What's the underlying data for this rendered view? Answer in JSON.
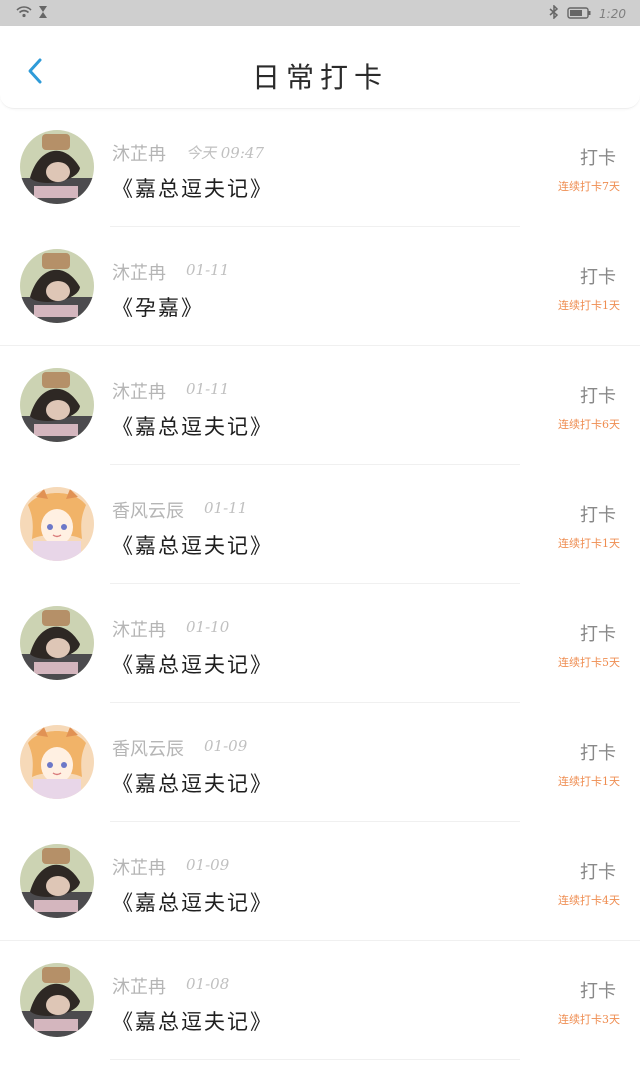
{
  "status": {
    "time": "1:20"
  },
  "header": {
    "title": "日常打卡"
  },
  "items": [
    {
      "name": "沐芷冉",
      "time": "今天 09:47",
      "text": "《嘉总逗夫记》",
      "action": "打卡",
      "streak": "连续打卡7天",
      "avatar": "avatar-photo-girl"
    },
    {
      "name": "沐芷冉",
      "time": "01-11",
      "text": "《孕嘉》",
      "action": "打卡",
      "streak": "连续打卡1天",
      "avatar": "avatar-photo-girl"
    },
    {
      "name": "沐芷冉",
      "time": "01-11",
      "text": "《嘉总逗夫记》",
      "action": "打卡",
      "streak": "连续打卡6天",
      "avatar": "avatar-photo-girl"
    },
    {
      "name": "香风云辰",
      "time": "01-11",
      "text": "《嘉总逗夫记》",
      "action": "打卡",
      "streak": "连续打卡1天",
      "avatar": "avatar-anime-girl"
    },
    {
      "name": "沐芷冉",
      "time": "01-10",
      "text": "《嘉总逗夫记》",
      "action": "打卡",
      "streak": "连续打卡5天",
      "avatar": "avatar-photo-girl"
    },
    {
      "name": "香风云辰",
      "time": "01-09",
      "text": "《嘉总逗夫记》",
      "action": "打卡",
      "streak": "连续打卡1天",
      "avatar": "avatar-anime-girl"
    },
    {
      "name": "沐芷冉",
      "time": "01-09",
      "text": "《嘉总逗夫记》",
      "action": "打卡",
      "streak": "连续打卡4天",
      "avatar": "avatar-photo-girl"
    },
    {
      "name": "沐芷冉",
      "time": "01-08",
      "text": "《嘉总逗夫记》",
      "action": "打卡",
      "streak": "连续打卡3天",
      "avatar": "avatar-photo-girl"
    }
  ],
  "icons": {
    "wifi": "wifi-icon",
    "hourglass": "hourglass-icon",
    "bluetooth": "bluetooth-icon",
    "battery": "battery-icon",
    "back": "chevron-left-icon"
  },
  "colors": {
    "status_bar": "#cfcfcf",
    "accent_blue": "#2f9bd8",
    "streak_orange": "#ef8d51"
  }
}
